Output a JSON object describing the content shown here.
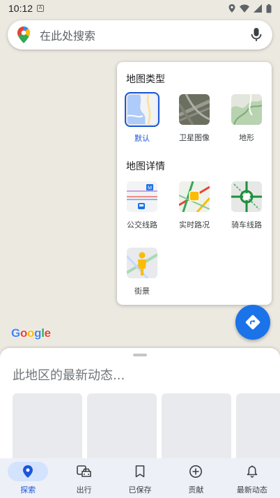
{
  "status_bar": {
    "time": "10:12",
    "notification_icon": "A"
  },
  "search": {
    "placeholder": "在此处搜索"
  },
  "layers_panel": {
    "map_type_title": "地图类型",
    "map_types": [
      {
        "label": "默认",
        "selected": true,
        "icon": "default-map-icon"
      },
      {
        "label": "卫星图像",
        "selected": false,
        "icon": "satellite-map-icon"
      },
      {
        "label": "地形",
        "selected": false,
        "icon": "terrain-map-icon"
      }
    ],
    "map_details_title": "地图详情",
    "map_details": [
      {
        "label": "公交线路",
        "icon": "transit-icon"
      },
      {
        "label": "实时路况",
        "icon": "traffic-icon"
      },
      {
        "label": "骑车线路",
        "icon": "biking-icon"
      },
      {
        "label": "街景",
        "icon": "street-view-icon"
      }
    ]
  },
  "google_logo": "Google",
  "bottom_sheet": {
    "title": "此地区的最新动态..."
  },
  "bottom_nav": [
    {
      "label": "探索",
      "active": true,
      "icon": "explore-pin-icon"
    },
    {
      "label": "出行",
      "active": false,
      "icon": "commute-icon"
    },
    {
      "label": "已保存",
      "active": false,
      "icon": "bookmark-icon"
    },
    {
      "label": "贡献",
      "active": false,
      "icon": "add-circle-icon"
    },
    {
      "label": "最新动态",
      "active": false,
      "icon": "bell-icon"
    }
  ],
  "colors": {
    "accent": "#1a73e8",
    "selected_text": "#1a56db",
    "map_bg": "#ece9e1"
  }
}
